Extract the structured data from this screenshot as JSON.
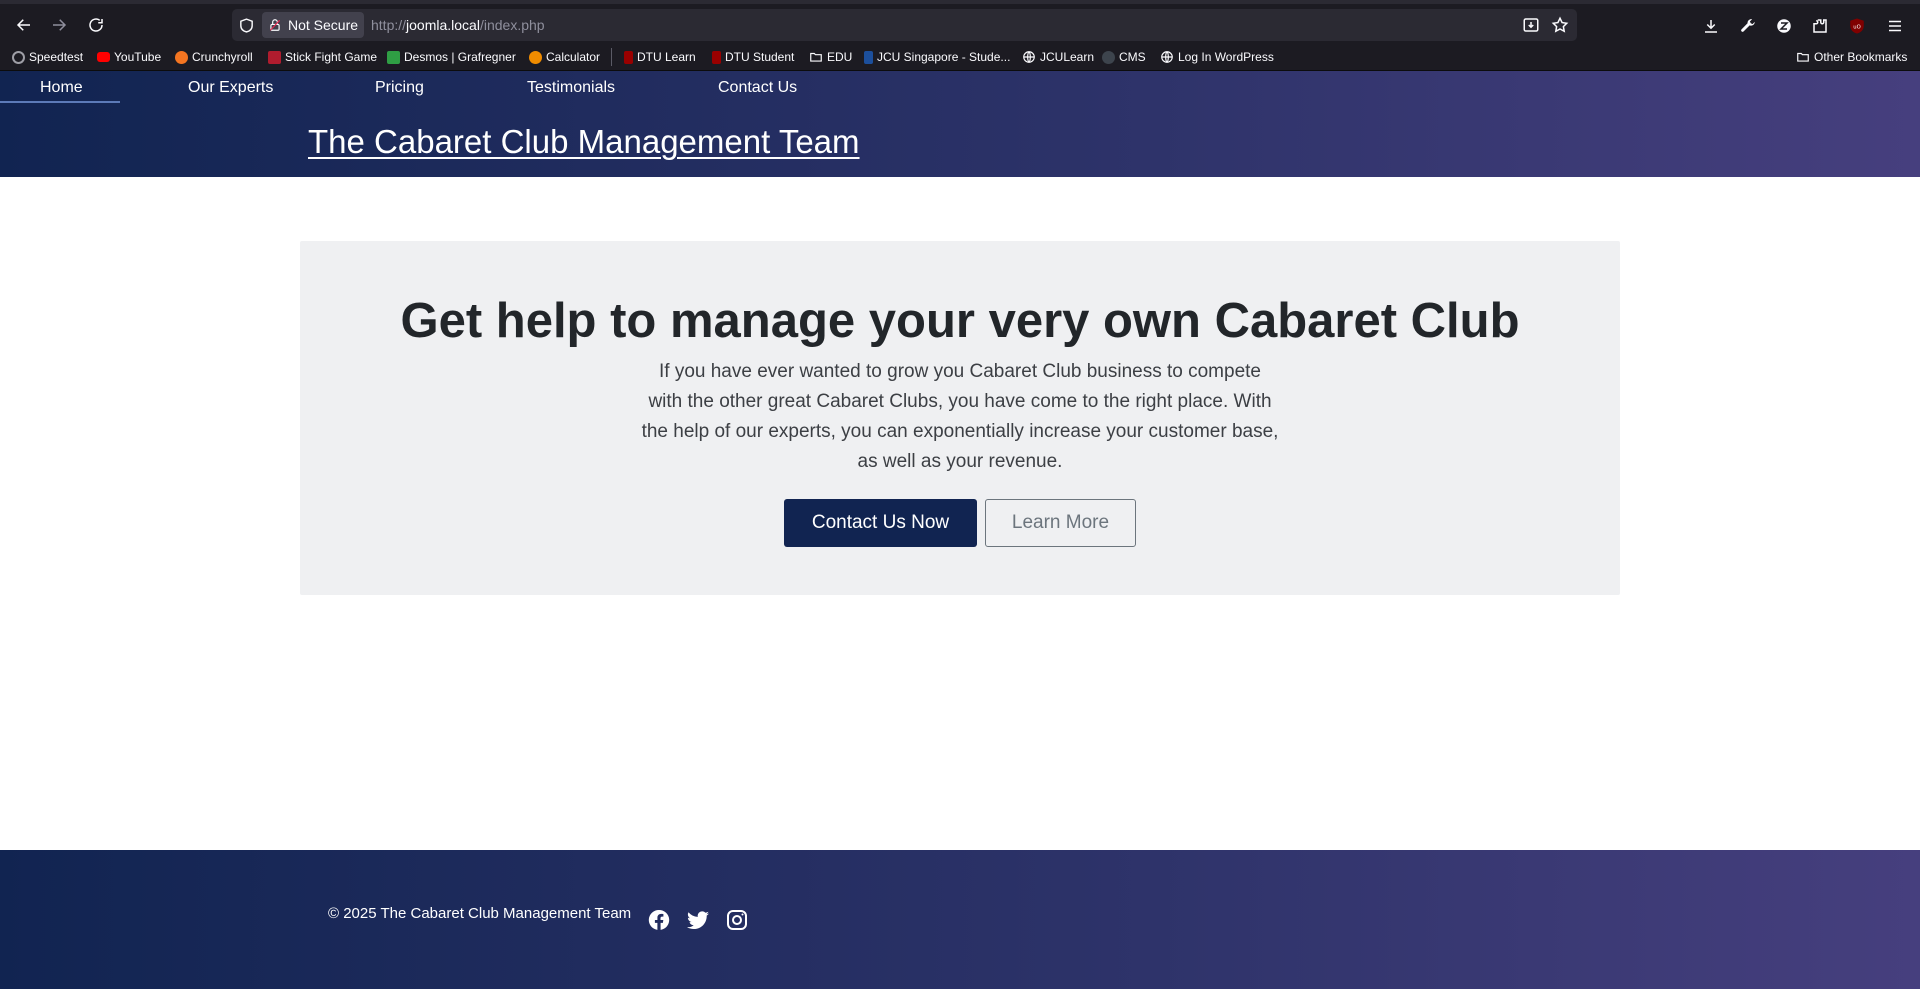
{
  "browser": {
    "not_secure_label": "Not Secure",
    "url_prefix": "http://",
    "url_host": "joomla.local",
    "url_path": "/index.php",
    "toolbar_icons": [
      "back-icon",
      "forward-icon",
      "reload-icon",
      "shield-icon",
      "lock-icon",
      "save-page-icon",
      "star-icon",
      "downloads-icon",
      "wrench-icon",
      "zotero-icon",
      "extensions-icon",
      "ublock-icon",
      "menu-icon"
    ]
  },
  "bookmarks": [
    {
      "label": "Speedtest",
      "color": "#9e9ea6"
    },
    {
      "label": "YouTube",
      "color": "#ff0000"
    },
    {
      "label": "Crunchyroll",
      "color": "#f47521"
    },
    {
      "label": "Stick Fight Game",
      "color": "#b01c2e"
    },
    {
      "label": "Desmos | Grafregner",
      "color": "#2f9e44"
    },
    {
      "label": "Calculator",
      "color": "#f08c00"
    },
    {
      "label": "DTU Learn",
      "color": "#990000"
    },
    {
      "label": "DTU Student",
      "color": "#990000"
    },
    {
      "label": "EDU",
      "color": "folder"
    },
    {
      "label": "JCU Singapore - Stude...",
      "color": "#1c4f9c"
    },
    {
      "label": "JCULearn",
      "color": "globe"
    },
    {
      "label": "CMS",
      "color": "#24292f"
    },
    {
      "label": "Log In WordPress",
      "color": "globe"
    }
  ],
  "other_bookmarks": "Other Bookmarks",
  "nav": {
    "items": [
      "Home",
      "Our Experts",
      "Pricing",
      "Testimonials",
      "Contact Us"
    ],
    "active": "Home"
  },
  "site_title": "The Cabaret Club Management Team",
  "hero": {
    "heading": "Get help to manage your very own Cabaret Club",
    "body": "If you have ever wanted to grow you Cabaret Club business to compete with the other great Cabaret Clubs, you have come to the right place. With the help of our experts, you can exponentially increase your customer base, as well as your revenue.",
    "primary_button": "Contact Us Now",
    "secondary_button": "Learn More"
  },
  "footer": {
    "copyright": "© 2025 The Cabaret Club Management Team",
    "social_icons": [
      "facebook-icon",
      "twitter-icon",
      "instagram-icon"
    ]
  },
  "colors": {
    "brand_dark": "#112451",
    "brand_purple": "#463f7e",
    "hero_bg": "#eff0f2",
    "heading_text": "#22262a"
  }
}
